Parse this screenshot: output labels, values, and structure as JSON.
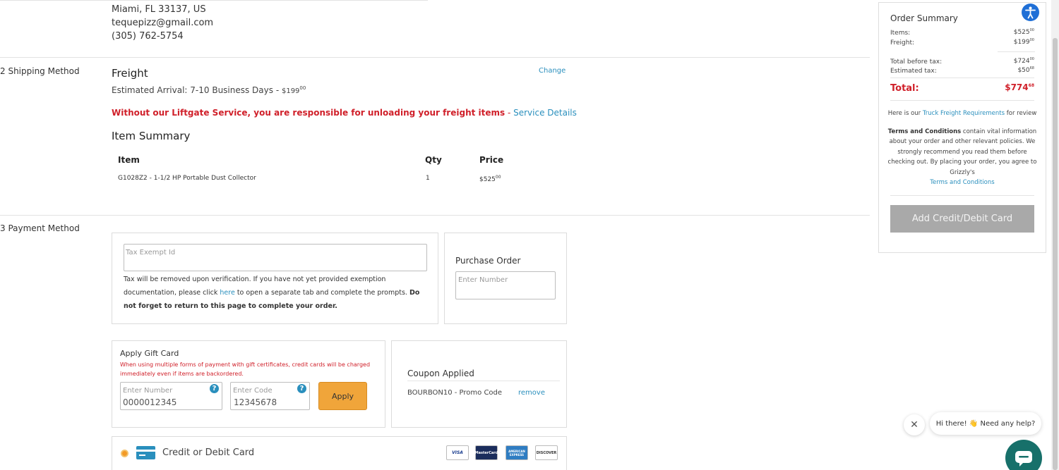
{
  "address": {
    "line2": "Miami, FL 33137, US",
    "email": "tequepizz@gmail.com",
    "phone": "(305) 762-5754"
  },
  "shipping": {
    "section_label": "2 Shipping Method",
    "method": "Freight",
    "eta_prefix": "Estimated Arrival: 7-10 Business Days - ",
    "eta_price_dollars": "$199",
    "eta_price_cents": "00",
    "change_label": "Change",
    "warning_text": "Without our Liftgate Service, you are responsible for unloading your freight items",
    "warning_sep": " - ",
    "service_details_label": "Service Details",
    "item_summary_title": "Item Summary",
    "columns": [
      "Item",
      "Qty",
      "Price"
    ],
    "items": [
      {
        "name": "G1028Z2 - 1-1/2 HP Portable Dust Collector",
        "qty": "1",
        "price_dollars": "$525",
        "price_cents": "00"
      }
    ]
  },
  "payment": {
    "section_label": "3 Payment Method",
    "tax_exempt": {
      "placeholder": "Tax Exempt Id",
      "note_part1": "Tax will be removed upon verification. If you have not yet provided exemption documentation, please click ",
      "here_link": "here",
      "note_part2": " to open a separate tab and complete the prompts. ",
      "note_bold": "Do not forget to return to this page to complete your order."
    },
    "purchase_order": {
      "title": "Purchase Order",
      "placeholder": "Enter Number"
    },
    "gift_card": {
      "title": "Apply Gift Card",
      "warning": "When using multiple forms of payment with gift certificates, credit cards will be charged immediately even if items are backordered.",
      "number_placeholder": "Enter Number",
      "number_value": "0000012345",
      "code_placeholder": "Enter Code",
      "code_value": "12345678",
      "apply_label": "Apply"
    },
    "coupon": {
      "title": "Coupon Applied",
      "code": "BOURBON10 - Promo Code",
      "remove_label": "remove"
    },
    "credit_card": {
      "label": "Credit or Debit Card",
      "brands": [
        "VISA",
        "MasterCard",
        "AMERICAN EXPRESS",
        "DISCOVER"
      ]
    }
  },
  "order_summary": {
    "title": "Order Summary",
    "items_label": "Items:",
    "items_dollars": "$525",
    "items_cents": "00",
    "freight_label": "Freight:",
    "freight_dollars": "$199",
    "freight_cents": "00",
    "before_tax_label": "Total before tax:",
    "before_tax_dollars": "$724",
    "before_tax_cents": "00",
    "tax_label": "Estimated tax:",
    "tax_dollars": "$50",
    "tax_cents": "68",
    "total_label": "Total:",
    "total_dollars": "$774",
    "total_cents": "68",
    "freight_req_prefix": "Here is our ",
    "freight_req_link": "Truck Freight Requirements",
    "freight_req_suffix": " for review",
    "terms_bold": "Terms and Conditions",
    "terms_text": " contain vital information about your order and other relevant policies. We strongly recommend you read them before checking out. By placing your order, you agree to Grizzly's",
    "terms_link": "Terms and Conditions",
    "add_card_label": "Add Credit/Debit Card"
  },
  "chat": {
    "greeting": "Hi there! 👋 Need any help?",
    "close_glyph": "✕"
  },
  "colors": {
    "link": "#2a8fbd",
    "warning": "#d0202a",
    "apply": "#f0a53a",
    "chat": "#17706a",
    "a11y": "#1f6fd6"
  }
}
